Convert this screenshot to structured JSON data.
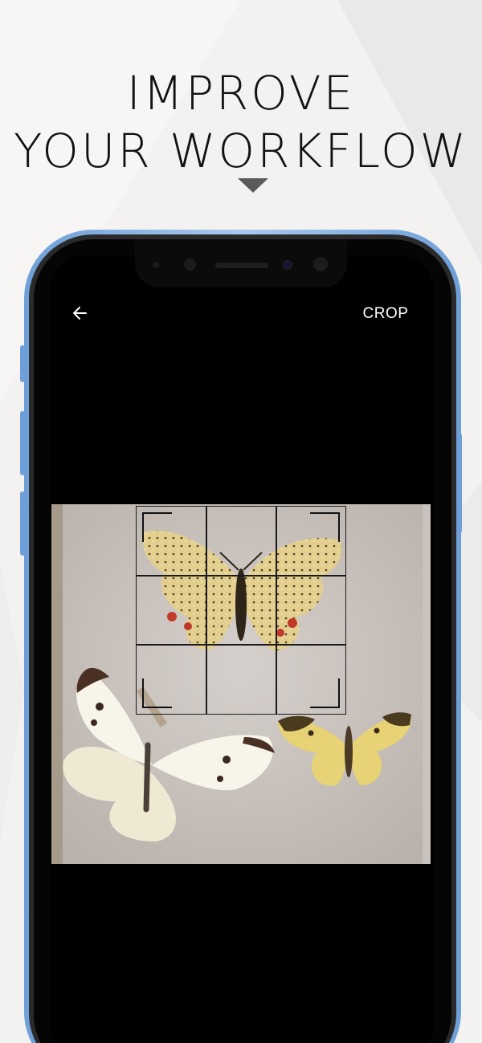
{
  "headline": {
    "line1": "IMPROVE",
    "line2": "YOUR WORKFLOW"
  },
  "editor": {
    "back_icon": "arrow-left-icon",
    "crop_label": "CROP",
    "crop_grid": "3x3"
  },
  "colors": {
    "page_background": "#f3f2f1",
    "phone_frame": "#6f9fd8",
    "screen": "#000000",
    "headline_text": "#111111"
  }
}
